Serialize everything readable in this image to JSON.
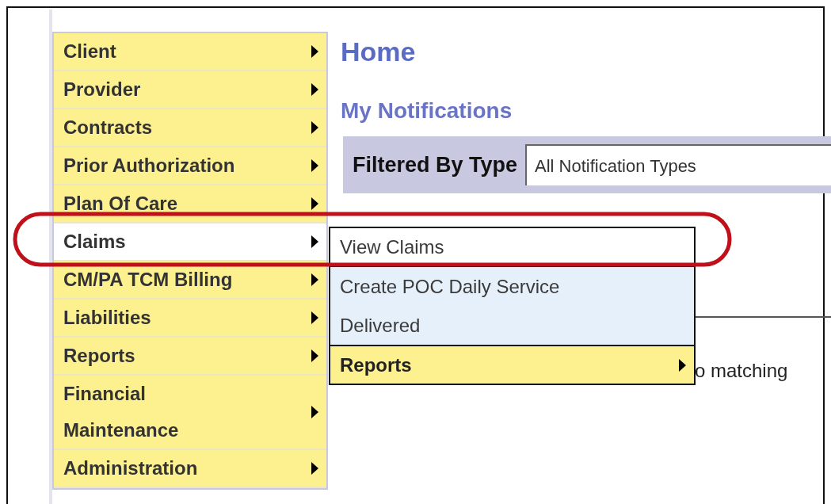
{
  "menu": [
    {
      "label": "Client",
      "selected": false
    },
    {
      "label": "Provider",
      "selected": false
    },
    {
      "label": "Contracts",
      "selected": false
    },
    {
      "label": "Prior Authorization",
      "selected": false
    },
    {
      "label": "Plan Of Care",
      "selected": false
    },
    {
      "label": "Claims",
      "selected": true
    },
    {
      "label": "CM/PA TCM Billing",
      "selected": false
    },
    {
      "label": "Liabilities",
      "selected": false
    },
    {
      "label": "Reports",
      "selected": false
    },
    {
      "label": "Financial Maintenance",
      "selected": false
    },
    {
      "label": "Administration",
      "selected": false
    }
  ],
  "submenu": [
    {
      "label": "View Claims",
      "kind": "link",
      "selected": true
    },
    {
      "label": "Create POC Daily Service",
      "kind": "link",
      "selected": false
    },
    {
      "label": "Delivered",
      "kind": "link",
      "selected": false
    },
    {
      "label": "Reports",
      "kind": "submenu",
      "selected": false
    }
  ],
  "page_title": "Home",
  "section_title": "My Notifications",
  "filter": {
    "label": "Filtered By Type",
    "value": "All Notification Types"
  },
  "message": "o matching"
}
